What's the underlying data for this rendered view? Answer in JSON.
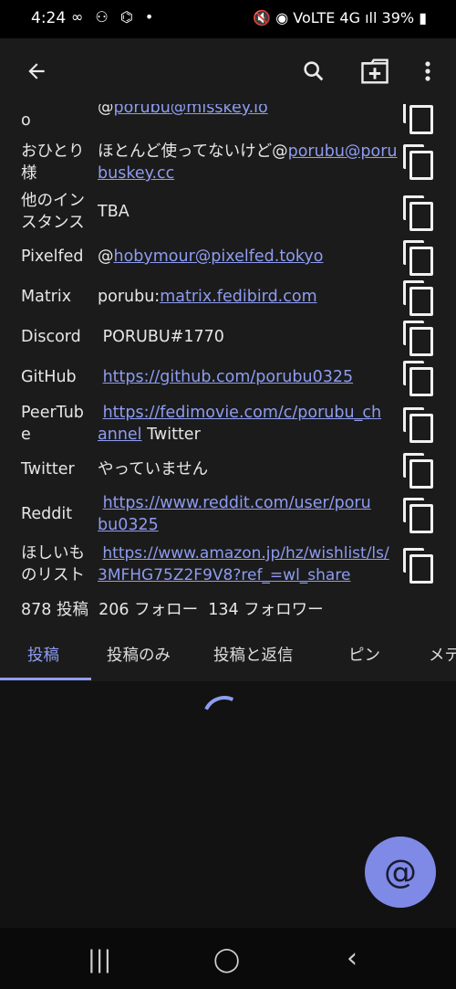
{
  "status_bar": {
    "time": "4:24",
    "left_icons": "∞ ⚇ ⌬ •",
    "right_icons": "🔇 ◉ VoLTE 4G ıll",
    "battery": "39%"
  },
  "app_bar": {
    "back_icon": "←",
    "search_icon": "⚲",
    "new_note_icon": "⊞",
    "more_icon": "⋮"
  },
  "fields": [
    {
      "label": "o",
      "value_prefix": "@",
      "value_link": "porubu@misskey.io",
      "value_suffix": ""
    },
    {
      "label": "おひとり様",
      "value_prefix": "ほとんど使ってないけど@",
      "value_link": "porubu@porubuskey.cc",
      "value_suffix": ""
    },
    {
      "label": "他のインスタンス",
      "value_prefix": "TBA",
      "value_link": "",
      "value_suffix": ""
    },
    {
      "label": "Pixelfed",
      "value_prefix": "@",
      "value_link": "hobymour@pixelfed.tokyo",
      "value_suffix": ""
    },
    {
      "label": "Matrix",
      "value_prefix": "porubu:",
      "value_link": "matrix.fedibird.com",
      "value_suffix": ""
    },
    {
      "label": "Discord",
      "value_prefix": " PORUBU#1770",
      "value_link": "",
      "value_suffix": ""
    },
    {
      "label": "GitHub",
      "value_prefix": " ",
      "value_link": "https://github.com/porubu0325",
      "value_suffix": ""
    },
    {
      "label": "PeerTube",
      "value_prefix": " ",
      "value_link": "https://fedimovie.com/c/porubu_channel",
      "value_suffix": " Twitter"
    },
    {
      "label": "Twitter",
      "value_prefix": "やっていません",
      "value_link": "",
      "value_suffix": ""
    },
    {
      "label": "Reddit",
      "value_prefix": " ",
      "value_link": "https://www.reddit.com/user/porubu0325",
      "value_suffix": ""
    },
    {
      "label": "ほしいものリスト",
      "value_prefix": " ",
      "value_link": "https://www.amazon.jp/hz/wishlist/ls/3MFHG75Z2F9V8?ref_=wl_share",
      "value_suffix": ""
    }
  ],
  "stats": {
    "notes": "878 投稿",
    "following": "206 フォロー",
    "followers": "134 フォロワー"
  },
  "tabs": [
    "投稿",
    "投稿のみ",
    "投稿と返信",
    "ピン",
    "メデ"
  ],
  "fab": {
    "icon": "@"
  },
  "nav_bar": {
    "recents": "|||",
    "home": "◯",
    "back": "‹"
  }
}
